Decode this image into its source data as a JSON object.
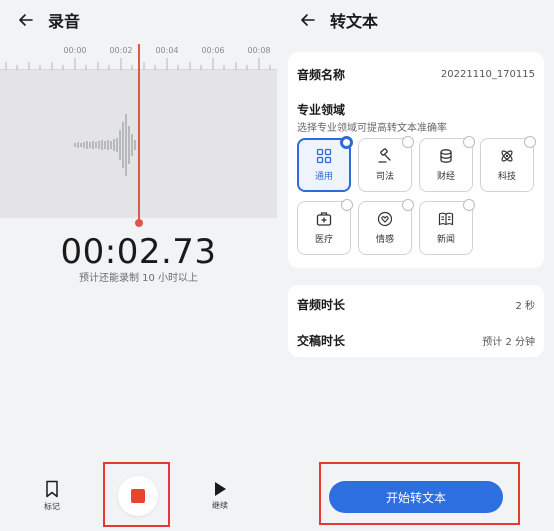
{
  "recorder": {
    "title": "录音",
    "timeline_ticks": [
      "00:00",
      "00:02",
      "00:04",
      "00:06",
      "00:08"
    ],
    "elapsed": "00:02.73",
    "remaining_note": "预计还能录制 10 小时以上",
    "controls": {
      "mark_label": "标记",
      "continue_label": "继续"
    }
  },
  "transcribe": {
    "title": "转文本",
    "audio_name_label": "音频名称",
    "audio_name_value": "20221110_170115",
    "domain_title": "专业领域",
    "domain_hint": "选择专业领域可提高转文本准确率",
    "domains": [
      {
        "label": "通用",
        "icon": "grid-icon",
        "selected": true
      },
      {
        "label": "司法",
        "icon": "gavel-icon",
        "selected": false
      },
      {
        "label": "财经",
        "icon": "coins-icon",
        "selected": false
      },
      {
        "label": "科技",
        "icon": "atom-icon",
        "selected": false
      },
      {
        "label": "医疗",
        "icon": "medkit-icon",
        "selected": false
      },
      {
        "label": "情感",
        "icon": "heart-icon",
        "selected": false
      },
      {
        "label": "新闻",
        "icon": "newspaper-icon",
        "selected": false
      }
    ],
    "duration_label": "音频时长",
    "duration_value": "2 秒",
    "delivery_label": "交稿时长",
    "delivery_value": "预计 2 分钟",
    "start_button": "开始转文本"
  },
  "colors": {
    "accent": "#2d6fe0",
    "record_red": "#e8452f",
    "highlight_red": "#e53935"
  }
}
